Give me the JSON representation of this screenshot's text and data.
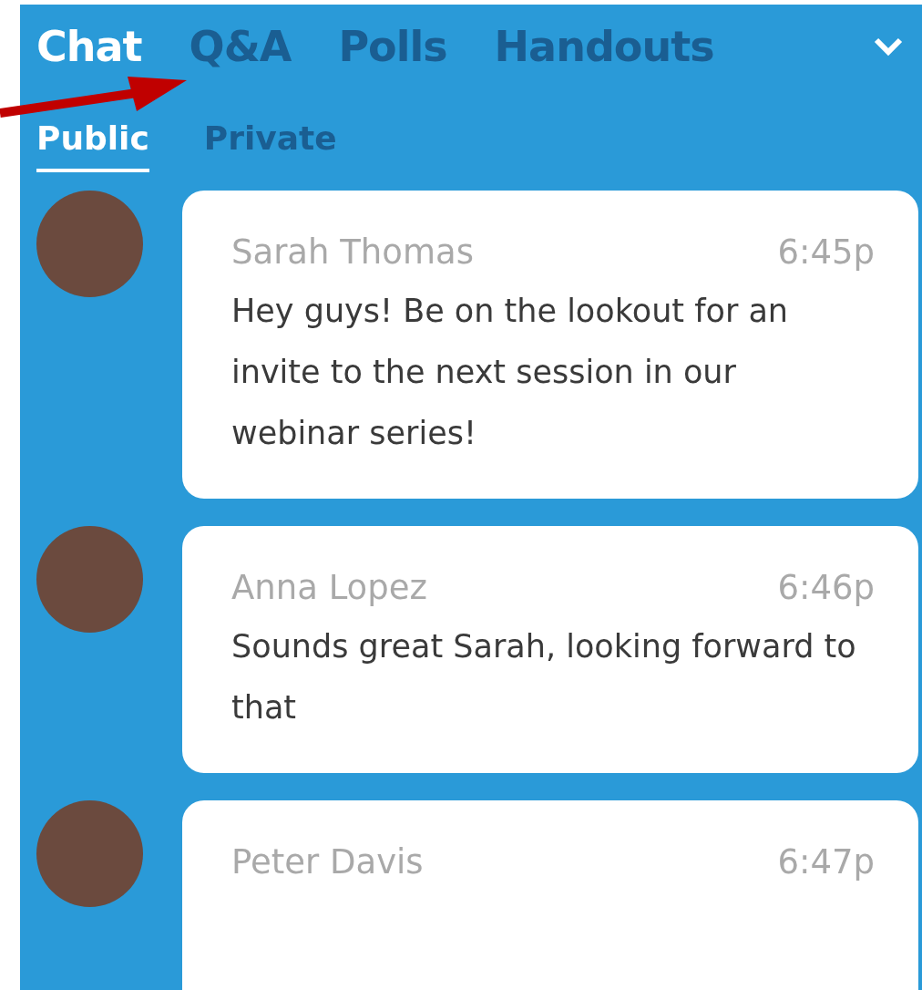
{
  "tabs": [
    {
      "label": "Chat",
      "selected": true
    },
    {
      "label": "Q&A",
      "selected": false
    },
    {
      "label": "Polls",
      "selected": false
    },
    {
      "label": "Handouts",
      "selected": false
    }
  ],
  "subtabs": [
    {
      "label": "Public",
      "selected": true
    },
    {
      "label": "Private",
      "selected": false
    }
  ],
  "messages": [
    {
      "name": "Sarah Thomas",
      "time": "6:45p",
      "text": "Hey guys! Be on the lookout for an invite to the next session in our webinar series!"
    },
    {
      "name": "Anna Lopez",
      "time": "6:46p",
      "text": "Sounds great Sarah, looking forward to that"
    },
    {
      "name": "Peter Davis",
      "time": "6:47p"
    }
  ]
}
